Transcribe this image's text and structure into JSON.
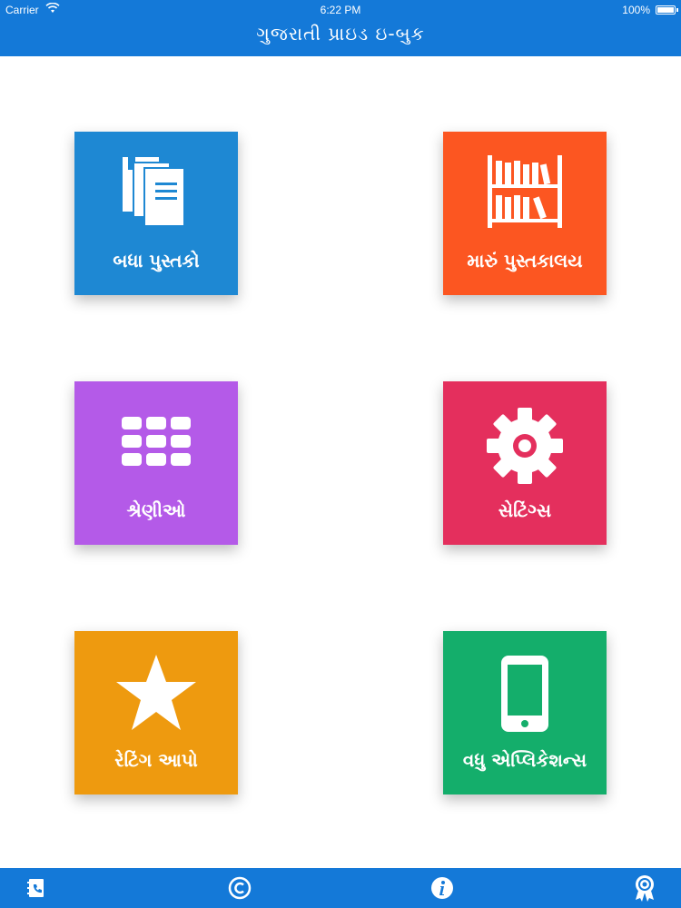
{
  "status_bar": {
    "carrier": "Carrier",
    "time": "6:22 PM",
    "battery": "100%"
  },
  "header": {
    "title": "ગુજરાતી પ્રાઇડ ઇ-બુક"
  },
  "tiles": [
    {
      "label": "બધા પુસ્તકો",
      "icon": "books-icon",
      "color": "#1e88d3"
    },
    {
      "label": "મારું પુસ્તકાલય",
      "icon": "bookshelf-icon",
      "color": "#fc5621"
    },
    {
      "label": "શ્રેણીઓ",
      "icon": "grid-icon",
      "color": "#b45ae8"
    },
    {
      "label": "સેટિંગ્સ",
      "icon": "gear-icon",
      "color": "#e42f5d"
    },
    {
      "label": "રેટિંગ આપો",
      "icon": "star-icon",
      "color": "#ee9a0f"
    },
    {
      "label": "વધુ એપ્લિકેશન્સ",
      "icon": "phone-icon",
      "color": "#14ae6b"
    }
  ],
  "bottom_bar": {
    "items": [
      "contacts-book-icon",
      "copyright-icon",
      "info-icon",
      "award-ribbon-icon"
    ]
  }
}
